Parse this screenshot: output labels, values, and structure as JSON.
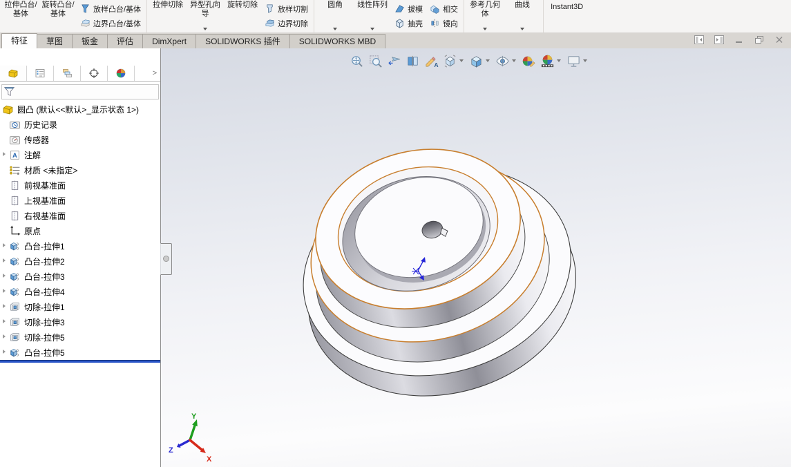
{
  "ribbon": {
    "instant3d_label": "Instant3D",
    "groups": [
      {
        "name": "boss-features",
        "columns": [
          {
            "type": "big",
            "name": "extruded-boss-base",
            "label": "拉伸凸台/基体"
          },
          {
            "type": "big",
            "name": "revolved-boss-base",
            "label": "旋转凸台/基体"
          },
          {
            "type": "stack",
            "rows": [
              {
                "name": "lofted-boss-base",
                "icon": "loft-boss",
                "label": "放样凸台/基体"
              },
              {
                "name": "boundary-boss-base",
                "icon": "boundary-boss",
                "label": "边界凸台/基体"
              }
            ]
          }
        ]
      },
      {
        "name": "cut-features",
        "columns": [
          {
            "type": "big",
            "name": "extruded-cut",
            "label": "拉伸切除"
          },
          {
            "type": "big",
            "name": "hole-wizard",
            "label": "异型孔向导",
            "dropdown": true
          },
          {
            "type": "big",
            "name": "revolved-cut",
            "label": "旋转切除"
          },
          {
            "type": "stack",
            "rows": [
              {
                "name": "lofted-cut",
                "icon": "loft-cut",
                "label": "放样切割"
              },
              {
                "name": "boundary-cut",
                "icon": "boundary-cut",
                "label": "边界切除"
              }
            ]
          }
        ]
      },
      {
        "name": "modify-features",
        "columns": [
          {
            "type": "big",
            "name": "fillet",
            "label": "圆角",
            "dropdown": true
          },
          {
            "type": "big",
            "name": "linear-pattern",
            "label": "线性阵列",
            "dropdown": true
          },
          {
            "type": "stack",
            "rows": [
              {
                "name": "draft",
                "icon": "draft",
                "label": "拔模"
              },
              {
                "name": "shell",
                "icon": "shell",
                "label": "抽壳"
              }
            ]
          },
          {
            "type": "stack",
            "rows": [
              {
                "name": "intersect",
                "icon": "intersect",
                "label": "相交"
              },
              {
                "name": "mirror",
                "icon": "mirror",
                "label": "镜向"
              }
            ]
          }
        ]
      },
      {
        "name": "reference",
        "columns": [
          {
            "type": "big",
            "name": "reference-geometry",
            "label": "参考几何体",
            "dropdown": true
          },
          {
            "type": "big",
            "name": "curves",
            "label": "曲线",
            "dropdown": true
          }
        ]
      }
    ]
  },
  "tabs": [
    {
      "id": "features",
      "label": "特征",
      "active": true
    },
    {
      "id": "sketch",
      "label": "草图",
      "active": false
    },
    {
      "id": "sheet-metal",
      "label": "钣金",
      "active": false
    },
    {
      "id": "evaluate",
      "label": "评估",
      "active": false
    },
    {
      "id": "dimxpert",
      "label": "DimXpert",
      "active": false
    },
    {
      "id": "solidworks-addins",
      "label": "SOLIDWORKS 插件",
      "active": false
    },
    {
      "id": "solidworks-mbd",
      "label": "SOLIDWORKS MBD",
      "active": false
    }
  ],
  "window_controls": [
    {
      "name": "pane-left"
    },
    {
      "name": "pane-right"
    },
    {
      "name": "minimize"
    },
    {
      "name": "restore"
    },
    {
      "name": "close"
    }
  ],
  "manager_tabs": [
    {
      "name": "featuremanager-tab",
      "icon": "part-yellow",
      "active": true
    },
    {
      "name": "propertymanager-tab",
      "icon": "property-list",
      "active": false
    },
    {
      "name": "configurationmanager-tab",
      "icon": "config-stack",
      "active": false
    },
    {
      "name": "dimxpertmanager-tab",
      "icon": "dimxpert-target",
      "active": false
    },
    {
      "name": "displaymanager-tab",
      "icon": "display-sphere",
      "active": false
    }
  ],
  "feature_tree": {
    "root_label": "圆凸 (默认<<默认>_显示状态 1>)",
    "items": [
      {
        "label": "历史记录",
        "icon": "history",
        "expandable": false
      },
      {
        "label": "传感器",
        "icon": "sensors",
        "expandable": false
      },
      {
        "label": "注解",
        "icon": "annotations",
        "expandable": true
      },
      {
        "label": "材质 <未指定>",
        "icon": "material",
        "expandable": false
      },
      {
        "label": "前视基准面",
        "icon": "plane",
        "expandable": false
      },
      {
        "label": "上视基准面",
        "icon": "plane",
        "expandable": false
      },
      {
        "label": "右视基准面",
        "icon": "plane",
        "expandable": false
      },
      {
        "label": "原点",
        "icon": "origin",
        "expandable": false
      },
      {
        "label": "凸台-拉伸1",
        "icon": "boss-extrude",
        "expandable": true
      },
      {
        "label": "凸台-拉伸2",
        "icon": "boss-extrude",
        "expandable": true
      },
      {
        "label": "凸台-拉伸3",
        "icon": "boss-extrude",
        "expandable": true
      },
      {
        "label": "凸台-拉伸4",
        "icon": "boss-extrude",
        "expandable": true
      },
      {
        "label": "切除-拉伸1",
        "icon": "cut-extrude",
        "expandable": true
      },
      {
        "label": "切除-拉伸3",
        "icon": "cut-extrude",
        "expandable": true
      },
      {
        "label": "切除-拉伸5",
        "icon": "cut-extrude",
        "expandable": true
      },
      {
        "label": "凸台-拉伸5",
        "icon": "boss-extrude",
        "expandable": true
      }
    ]
  },
  "hud": [
    {
      "name": "zoom-to-fit",
      "dropdown": false
    },
    {
      "name": "zoom-to-area",
      "dropdown": false
    },
    {
      "name": "previous-view",
      "dropdown": false
    },
    {
      "name": "section-view",
      "dropdown": false
    },
    {
      "name": "annotation-view",
      "dropdown": false
    },
    {
      "name": "view-orientation",
      "dropdown": true
    },
    {
      "name": "display-style",
      "dropdown": true
    },
    {
      "name": "hide-show-items",
      "dropdown": true
    },
    {
      "name": "edit-appearance",
      "dropdown": false
    },
    {
      "name": "apply-scene",
      "dropdown": true
    },
    {
      "name": "view-settings",
      "dropdown": true
    }
  ],
  "viewport": {
    "triad": {
      "x": "X",
      "y": "Y",
      "z": "Z"
    }
  },
  "colors": {
    "highlight_edge": "#c87f2f",
    "rollback_bar": "#2a55c8",
    "triad_x": "#d62a1a",
    "triad_y": "#1f9e1f",
    "triad_z": "#2a2ad0"
  }
}
